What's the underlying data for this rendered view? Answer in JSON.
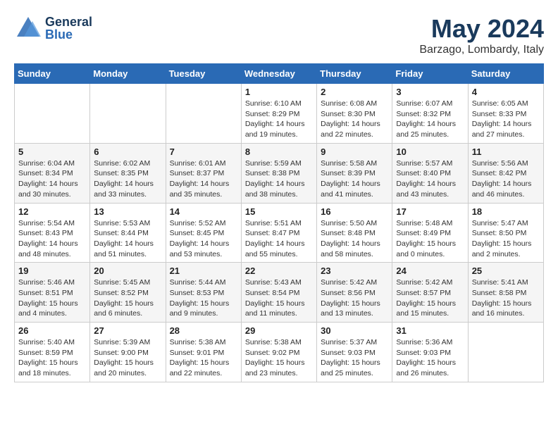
{
  "header": {
    "logo_general": "General",
    "logo_blue": "Blue",
    "title": "May 2024",
    "subtitle": "Barzago, Lombardy, Italy"
  },
  "calendar": {
    "headers": [
      "Sunday",
      "Monday",
      "Tuesday",
      "Wednesday",
      "Thursday",
      "Friday",
      "Saturday"
    ],
    "weeks": [
      [
        {
          "day": "",
          "info": ""
        },
        {
          "day": "",
          "info": ""
        },
        {
          "day": "",
          "info": ""
        },
        {
          "day": "1",
          "info": "Sunrise: 6:10 AM\nSunset: 8:29 PM\nDaylight: 14 hours\nand 19 minutes."
        },
        {
          "day": "2",
          "info": "Sunrise: 6:08 AM\nSunset: 8:30 PM\nDaylight: 14 hours\nand 22 minutes."
        },
        {
          "day": "3",
          "info": "Sunrise: 6:07 AM\nSunset: 8:32 PM\nDaylight: 14 hours\nand 25 minutes."
        },
        {
          "day": "4",
          "info": "Sunrise: 6:05 AM\nSunset: 8:33 PM\nDaylight: 14 hours\nand 27 minutes."
        }
      ],
      [
        {
          "day": "5",
          "info": "Sunrise: 6:04 AM\nSunset: 8:34 PM\nDaylight: 14 hours\nand 30 minutes."
        },
        {
          "day": "6",
          "info": "Sunrise: 6:02 AM\nSunset: 8:35 PM\nDaylight: 14 hours\nand 33 minutes."
        },
        {
          "day": "7",
          "info": "Sunrise: 6:01 AM\nSunset: 8:37 PM\nDaylight: 14 hours\nand 35 minutes."
        },
        {
          "day": "8",
          "info": "Sunrise: 5:59 AM\nSunset: 8:38 PM\nDaylight: 14 hours\nand 38 minutes."
        },
        {
          "day": "9",
          "info": "Sunrise: 5:58 AM\nSunset: 8:39 PM\nDaylight: 14 hours\nand 41 minutes."
        },
        {
          "day": "10",
          "info": "Sunrise: 5:57 AM\nSunset: 8:40 PM\nDaylight: 14 hours\nand 43 minutes."
        },
        {
          "day": "11",
          "info": "Sunrise: 5:56 AM\nSunset: 8:42 PM\nDaylight: 14 hours\nand 46 minutes."
        }
      ],
      [
        {
          "day": "12",
          "info": "Sunrise: 5:54 AM\nSunset: 8:43 PM\nDaylight: 14 hours\nand 48 minutes."
        },
        {
          "day": "13",
          "info": "Sunrise: 5:53 AM\nSunset: 8:44 PM\nDaylight: 14 hours\nand 51 minutes."
        },
        {
          "day": "14",
          "info": "Sunrise: 5:52 AM\nSunset: 8:45 PM\nDaylight: 14 hours\nand 53 minutes."
        },
        {
          "day": "15",
          "info": "Sunrise: 5:51 AM\nSunset: 8:47 PM\nDaylight: 14 hours\nand 55 minutes."
        },
        {
          "day": "16",
          "info": "Sunrise: 5:50 AM\nSunset: 8:48 PM\nDaylight: 14 hours\nand 58 minutes."
        },
        {
          "day": "17",
          "info": "Sunrise: 5:48 AM\nSunset: 8:49 PM\nDaylight: 15 hours\nand 0 minutes."
        },
        {
          "day": "18",
          "info": "Sunrise: 5:47 AM\nSunset: 8:50 PM\nDaylight: 15 hours\nand 2 minutes."
        }
      ],
      [
        {
          "day": "19",
          "info": "Sunrise: 5:46 AM\nSunset: 8:51 PM\nDaylight: 15 hours\nand 4 minutes."
        },
        {
          "day": "20",
          "info": "Sunrise: 5:45 AM\nSunset: 8:52 PM\nDaylight: 15 hours\nand 6 minutes."
        },
        {
          "day": "21",
          "info": "Sunrise: 5:44 AM\nSunset: 8:53 PM\nDaylight: 15 hours\nand 9 minutes."
        },
        {
          "day": "22",
          "info": "Sunrise: 5:43 AM\nSunset: 8:54 PM\nDaylight: 15 hours\nand 11 minutes."
        },
        {
          "day": "23",
          "info": "Sunrise: 5:42 AM\nSunset: 8:56 PM\nDaylight: 15 hours\nand 13 minutes."
        },
        {
          "day": "24",
          "info": "Sunrise: 5:42 AM\nSunset: 8:57 PM\nDaylight: 15 hours\nand 15 minutes."
        },
        {
          "day": "25",
          "info": "Sunrise: 5:41 AM\nSunset: 8:58 PM\nDaylight: 15 hours\nand 16 minutes."
        }
      ],
      [
        {
          "day": "26",
          "info": "Sunrise: 5:40 AM\nSunset: 8:59 PM\nDaylight: 15 hours\nand 18 minutes."
        },
        {
          "day": "27",
          "info": "Sunrise: 5:39 AM\nSunset: 9:00 PM\nDaylight: 15 hours\nand 20 minutes."
        },
        {
          "day": "28",
          "info": "Sunrise: 5:38 AM\nSunset: 9:01 PM\nDaylight: 15 hours\nand 22 minutes."
        },
        {
          "day": "29",
          "info": "Sunrise: 5:38 AM\nSunset: 9:02 PM\nDaylight: 15 hours\nand 23 minutes."
        },
        {
          "day": "30",
          "info": "Sunrise: 5:37 AM\nSunset: 9:03 PM\nDaylight: 15 hours\nand 25 minutes."
        },
        {
          "day": "31",
          "info": "Sunrise: 5:36 AM\nSunset: 9:03 PM\nDaylight: 15 hours\nand 26 minutes."
        },
        {
          "day": "",
          "info": ""
        }
      ]
    ]
  }
}
